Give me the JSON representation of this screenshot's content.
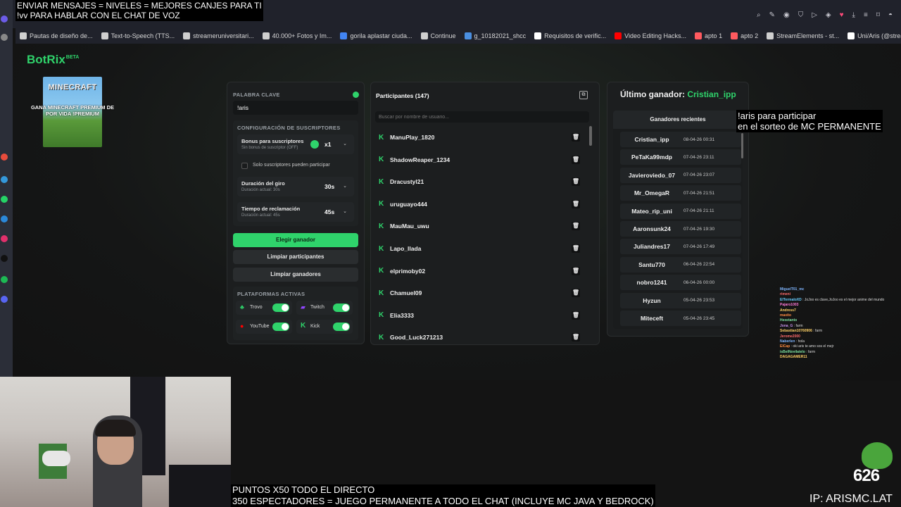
{
  "overlay": {
    "top_line1": "ENVIAR MENSAJES = NIVELES = MEJORES CANJES PARA TI",
    "top_line2": "!vv PARA HABLAR CON EL CHAT DE VOZ",
    "right_line1": "!aris para participar",
    "right_line2": "en el sorteo de MC PERMANENTE",
    "bottom_line1": "PUNTOS X50 TODO EL DIRECTO",
    "bottom_line2": "350 ESPECTADORES = JUEGO PERMANENTE A TODO EL CHAT (INCLUYE MC JAVA Y BEDROCK)",
    "ip": "IP: ARISMC.LAT",
    "counter": "626",
    "promo_title": "MINECRAFT",
    "promo_caption": "GANA MINECRAFT PREMIUM DE POR VIDA !PREMIUM"
  },
  "bookmarks": [
    {
      "label": "Pautas de diseño de...",
      "color": "#cfcfcf"
    },
    {
      "label": "Text-to-Speech (TTS...",
      "color": "#cfcfcf"
    },
    {
      "label": "streameruniversitari...",
      "color": "#cfcfcf"
    },
    {
      "label": "40.000+ Fotos y Im...",
      "color": "#cfcfcf"
    },
    {
      "label": "gorila aplastar ciuda...",
      "color": "#4285f4"
    },
    {
      "label": "Continue",
      "color": "#cfcfcf"
    },
    {
      "label": "g_10182021_shcc",
      "color": "#4a8fe0"
    },
    {
      "label": "Requisitos de verific...",
      "color": "#ffffff"
    },
    {
      "label": "Video Editing Hacks...",
      "color": "#ff0000"
    },
    {
      "label": "apto 1",
      "color": "#ff5a5f"
    },
    {
      "label": "apto 2",
      "color": "#ff5a5f"
    },
    {
      "label": "StreamElements - st...",
      "color": "#cfcfcf"
    },
    {
      "label": "Uni/Aris (@streame...",
      "color": "#ffffff"
    }
  ],
  "site": {
    "logo": "BotRix",
    "logo_badge": "BETA"
  },
  "settings": {
    "keyword_label": "PALABRA CLAVE",
    "keyword_value": "!aris",
    "subs_section": "CONFIGURACIÓN DE SUSCRIPTORES",
    "bonus_label": "Bonus para suscriptores",
    "bonus_sub": "Sin bonus de suscriptor (OFF)",
    "bonus_value": "x1",
    "subs_only": "Solo suscriptores pueden participar",
    "spin_label": "Duración del giro",
    "spin_sub": "Duración actual: 30s",
    "spin_value": "30s",
    "claim_label": "Tiempo de reclamación",
    "claim_sub": "Duración actual: 45s",
    "claim_value": "45s",
    "btn_pick": "Elegir ganador",
    "btn_clear_participants": "Limpiar participantes",
    "btn_clear_winners": "Limpiar ganadores",
    "platforms_label": "PLATAFORMAS ACTIVAS",
    "platforms": [
      {
        "name": "Trovo",
        "on": true
      },
      {
        "name": "Twitch",
        "on": true
      },
      {
        "name": "YouTube",
        "on": true
      },
      {
        "name": "Kick",
        "on": true
      }
    ]
  },
  "participants": {
    "title": "Participantes (147)",
    "search_placeholder": "Buscar por nombre de usuario...",
    "list": [
      "ManuPlay_1820",
      "ShadowReaper_1234",
      "Dracustyl21",
      "uruguayo444",
      "MauMau_uwu",
      "Lapo_llada",
      "elprimoby02",
      "Chamuel09",
      "Elia3333",
      "Good_Luck271213"
    ]
  },
  "winners": {
    "last_label": "Último ganador:",
    "last_name": "Cristian_ipp",
    "recent_title": "Ganadores recientes",
    "list": [
      {
        "name": "Cristian_ipp",
        "date": "08-04-26 00:31"
      },
      {
        "name": "PeTaKa99mdp",
        "date": "07-04-26 23:11"
      },
      {
        "name": "Javieroviedo_07",
        "date": "07-04-26 23:07"
      },
      {
        "name": "Mr_OmegaR",
        "date": "07-04-26 21:51"
      },
      {
        "name": "Mateo_rip_uni",
        "date": "07-04-26 21:11"
      },
      {
        "name": "Aaronsunk24",
        "date": "07-04-26 19:30"
      },
      {
        "name": "Juliandres17",
        "date": "07-04-26 17:49"
      },
      {
        "name": "Santu770",
        "date": "06-04-26 22:54"
      },
      {
        "name": "nobro1241",
        "date": "06-04-26 00:00"
      },
      {
        "name": "Hyzun",
        "date": "05-04-26 23:53"
      },
      {
        "name": "Miteceft",
        "date": "05-04-26 23:45"
      }
    ]
  },
  "chat": [
    {
      "user": "MiguelT01_mc",
      "text": "",
      "color": "#7fb6ff"
    },
    {
      "user": "rimeni",
      "text": "",
      "color": "#ff6b6b"
    },
    {
      "user": "ElTermaloXD",
      "text": "JoJoo es clave,JoJoo es el mejor anime del mundo",
      "color": "#66ccff"
    },
    {
      "user": "Pajaro1003",
      "text": "",
      "color": "#ff7ad9"
    },
    {
      "user": "Andress7",
      "text": "",
      "color": "#ffd166"
    },
    {
      "user": "maxito",
      "text": "",
      "color": "#ff8c42"
    },
    {
      "user": "Hexetanto",
      "text": "",
      "color": "#7fe3a0"
    },
    {
      "user": "Jona_G",
      "text": "farm",
      "color": "#c792ea"
    },
    {
      "user": "Sebastian10760906",
      "text": "farm",
      "color": "#ffd166"
    },
    {
      "user": "Jerome2000",
      "text": "",
      "color": "#ff6b6b"
    },
    {
      "user": "Naberlen",
      "text": "hola",
      "color": "#7fb6ff"
    },
    {
      "user": "ElCap",
      "text": "oki aris te amo sos el mejr",
      "color": "#ff8c42"
    },
    {
      "user": "isBelNovilatelo",
      "text": "farm",
      "color": "#7fe3a0"
    },
    {
      "user": "DAGAGAMER11",
      "text": "",
      "color": "#ffd166"
    }
  ]
}
